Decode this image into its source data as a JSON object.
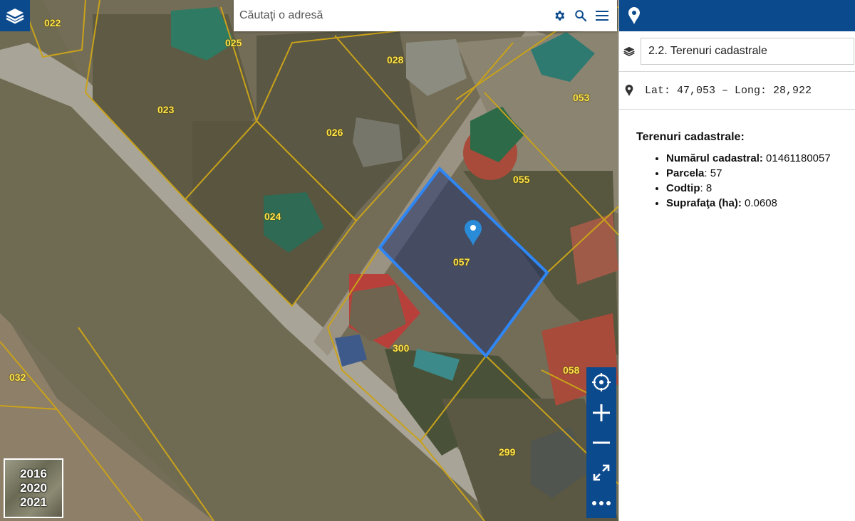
{
  "search": {
    "placeholder": "Căutaţi o adresă"
  },
  "icons": {
    "layers": "layers-icon",
    "settings": "gear-icon",
    "search": "search-icon",
    "menu": "hamburger-menu-icon",
    "location": "map-pin-icon",
    "locate": "crosshair-icon",
    "zoom_in": "plus-icon",
    "zoom_out": "minus-icon",
    "fullscreen": "expand-icon",
    "more": "more-dots-icon"
  },
  "map": {
    "parcels": [
      "022",
      "025",
      "028",
      "023",
      "026",
      "053",
      "055",
      "024",
      "057",
      "300",
      "032",
      "058",
      "299"
    ],
    "selected_parcel": "057",
    "years": [
      "2016",
      "2020",
      "2021"
    ]
  },
  "panel": {
    "layer": "2.2. Terenuri cadastrale",
    "coordinates": "Lat: 47,053 – Long: 28,922",
    "info_title": "Terenuri cadastrale:",
    "fields": [
      {
        "label": "Numărul cadastral:",
        "value": " 01461180057"
      },
      {
        "label": "Parcela",
        "value": ": 57"
      },
      {
        "label": "Codtip",
        "value": ": 8"
      },
      {
        "label": "Suprafaţa (ha):",
        "value": " 0.0608"
      }
    ]
  },
  "colors": {
    "brand": "#0b4a8c",
    "parcel_line": "#c9a21a",
    "selection": "#2f86f5",
    "label": "#ffe34a"
  }
}
